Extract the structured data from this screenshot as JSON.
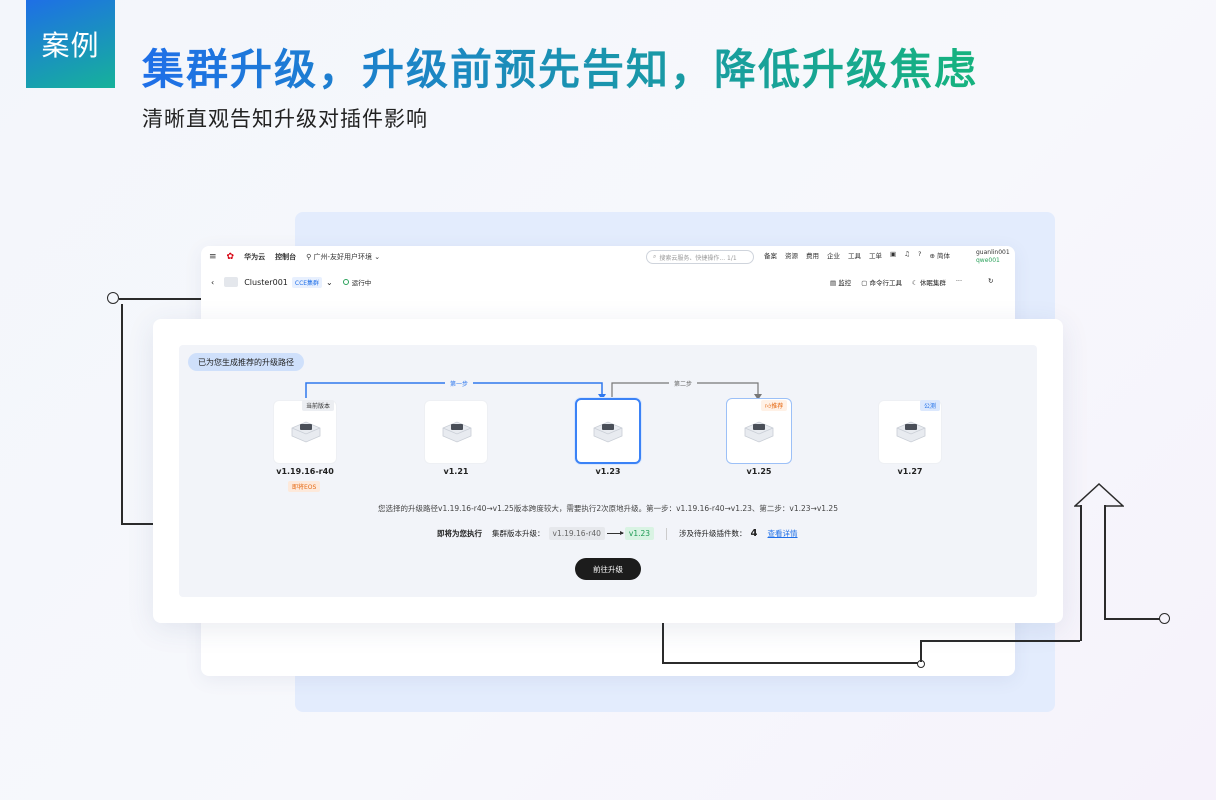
{
  "badge": "案例",
  "headline": "集群升级，升级前预先告知，降低升级焦虑",
  "subheadline": "清晰直观告知升级对插件影响",
  "console": {
    "brand": "华为云",
    "console_label": "控制台",
    "region": "广州-友好用户环境",
    "search_placeholder": "搜索云服务、快捷操作... 1/1",
    "top_menu": [
      "备案",
      "资源",
      "费用",
      "企业",
      "工具",
      "工单"
    ],
    "language": "简体",
    "user_name": "guanlin001",
    "user_sub": "qwe001",
    "cluster_name": "Cluster001",
    "cluster_tag": "CCE集群",
    "status": "运行中",
    "tools": [
      "监控",
      "命令行工具",
      "休眠集群"
    ]
  },
  "upgrade": {
    "path_title": "已为您生成推荐的升级路径",
    "step1_label": "第一步",
    "step2_label": "第二步",
    "nodes": [
      {
        "version": "v1.19.16-r40",
        "tag": "当前版本",
        "note": "即将EOS"
      },
      {
        "version": "v1.21"
      },
      {
        "version": "v1.23"
      },
      {
        "version": "v1.25",
        "tag": "推荐"
      },
      {
        "version": "v1.27",
        "tag": "公测"
      }
    ],
    "description": "您选择的升级路径v1.19.16-r40→v1.25版本跨度较大，需要执行2次原地升级。第一步：v1.19.16-r40→v1.23、第二步：v1.23→v1.25",
    "exec_label": "即将为您执行",
    "cluster_upgrade_label": "集群版本升级：",
    "from_version": "v1.19.16-r40",
    "to_version": "v1.23",
    "plugin_label": "涉及待升级插件数：",
    "plugin_count": "4",
    "detail_link": "查看详情",
    "go_button": "前往升级"
  }
}
